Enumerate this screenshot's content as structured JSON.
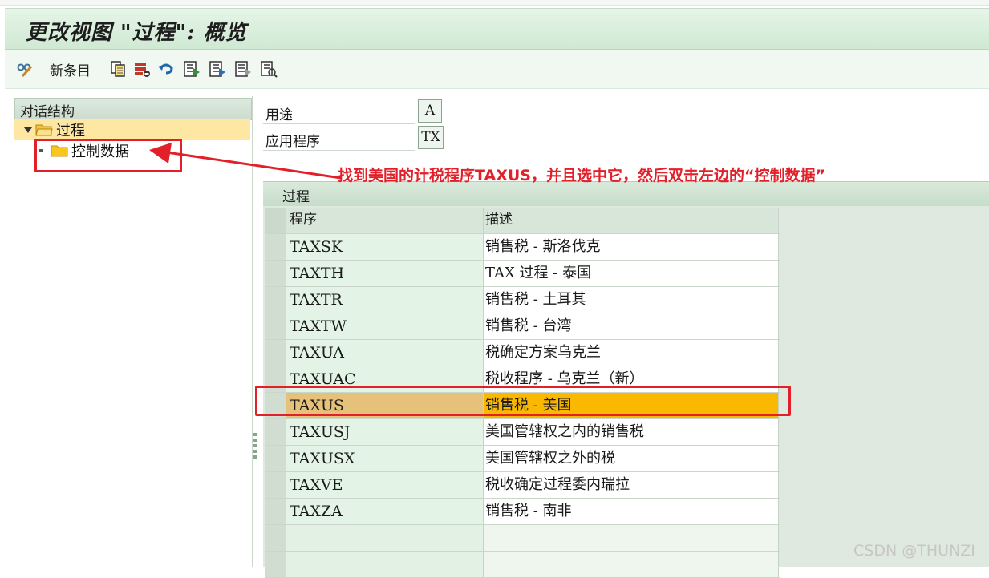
{
  "window": {
    "title": "更改视图 \"过程\": 概览"
  },
  "toolbar": {
    "new_entries_label": "新条目",
    "icons": [
      "glasses-edit-icon",
      "copy-icon",
      "delete-icon",
      "undo-icon",
      "select-all-icon",
      "select-block-icon",
      "deselect-all-icon",
      "print-icon"
    ]
  },
  "dialog_structure": {
    "header": "对话结构",
    "items": [
      {
        "label": "过程",
        "expanded": true,
        "selected": true
      },
      {
        "label": "控制数据",
        "expanded": false,
        "selected": false
      }
    ]
  },
  "fields": {
    "usage": {
      "label": "用途",
      "value": "A"
    },
    "application": {
      "label": "应用程序",
      "value": "TX"
    }
  },
  "procedures": {
    "section_title": "过程",
    "columns": {
      "code": "程序",
      "description": "描述"
    },
    "rows": [
      {
        "code": "TAXSK",
        "description": "销售税 - 斯洛伐克"
      },
      {
        "code": "TAXTH",
        "description": "TAX 过程 - 泰国"
      },
      {
        "code": "TAXTR",
        "description": "销售税 - 土耳其"
      },
      {
        "code": "TAXTW",
        "description": "销售税 - 台湾"
      },
      {
        "code": "TAXUA",
        "description": "税确定方案乌克兰"
      },
      {
        "code": "TAXUAC",
        "description": "税收程序 - 乌克兰（新）"
      },
      {
        "code": "TAXUS",
        "description": "销售税 - 美国",
        "selected": true
      },
      {
        "code": "TAXUSJ",
        "description": "美国管辖权之内的销售税"
      },
      {
        "code": "TAXUSX",
        "description": "美国管辖权之外的税"
      },
      {
        "code": "TAXVE",
        "description": "税收确定过程委内瑞拉"
      },
      {
        "code": "TAXZA",
        "description": "销售税 - 南非"
      }
    ]
  },
  "annotation": {
    "text": "找到美国的计税程序TAXUS，并且选中它，然后双击左边的“控制数据”",
    "color": "#e2202a"
  },
  "watermark": "CSDN @THUNZI",
  "colors": {
    "selected_row": "#fbb800",
    "selected_code": "#e5c179",
    "header_green": "#cfe9d3"
  }
}
